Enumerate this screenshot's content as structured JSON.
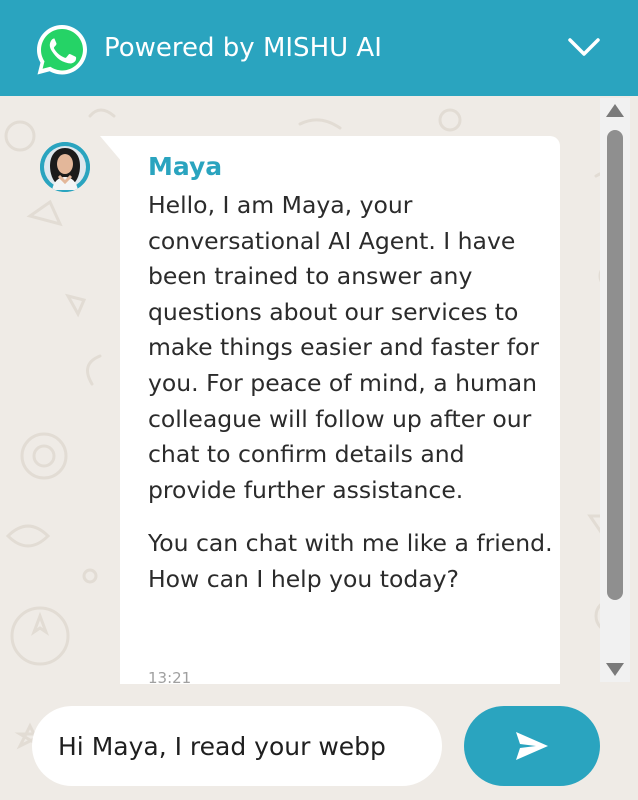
{
  "header": {
    "title": "Powered by MISHU AI",
    "logo_icon": "whatsapp-icon",
    "collapse_icon": "chevron-down-icon"
  },
  "colors": {
    "accent": "#2aa4bf",
    "chat_background": "#efebe6",
    "bubble": "#ffffff",
    "text": "#2b2b2b",
    "timestamp": "#a0a0a0"
  },
  "message": {
    "sender": "Maya",
    "avatar_icon": "avatar",
    "paragraphs": [
      "Hello, I am Maya, your conversational AI Agent. I have been trained to answer any questions about our services to make things easier and faster for you. For peace of mind, a human colleague will follow up after our chat to confirm details and provide further assistance.",
      "You can chat with me like a friend. How can I help you today?"
    ],
    "time": "13:21"
  },
  "composer": {
    "value": "Hi Maya, I read your webp",
    "send_icon": "send-icon"
  },
  "scrollbar": {
    "up_icon": "triangle-up-icon",
    "down_icon": "triangle-down-icon"
  }
}
